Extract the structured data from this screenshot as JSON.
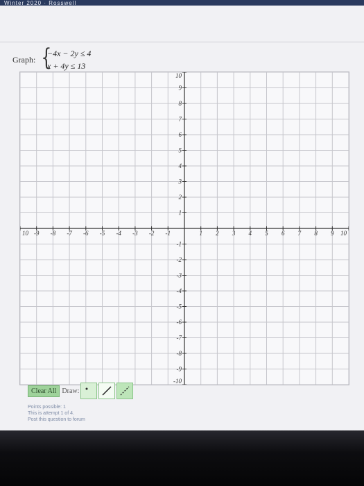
{
  "top_strip_text": "Winter 2020 · Rosswell",
  "problem": {
    "label": "Graph:",
    "inequality_1": "−4x − 2y ≤ 4",
    "inequality_2": "x + 4y ≤ 13"
  },
  "grid": {
    "x_range": [
      -10,
      10
    ],
    "y_range": [
      -10,
      10
    ],
    "x_tick_labels": [
      "10",
      "-9",
      "-8",
      "-7",
      "-6",
      "-5",
      "-4",
      "-3",
      "-2",
      "-1",
      "1",
      "2",
      "3",
      "4",
      "5",
      "6",
      "7",
      "8",
      "9",
      "10"
    ],
    "y_tick_labels": [
      "10",
      "9",
      "8",
      "7",
      "6",
      "5",
      "4",
      "3",
      "2",
      "1",
      "-1",
      "-2",
      "-3",
      "-4",
      "-5",
      "-6",
      "-7",
      "-8",
      "-9",
      "-10"
    ],
    "grid_color": "#c6c6cc",
    "axis_color": "#333333"
  },
  "controls": {
    "clear_label": "Clear All",
    "draw_label": "Draw:",
    "tools": [
      "point-icon",
      "solid-line-icon",
      "dashed-line-icon"
    ]
  },
  "status": {
    "points": "Points possible: 1",
    "attempt": "This is attempt 1 of 4.",
    "forum": "Post this question to forum"
  },
  "colors": {
    "clear_button": "#9ed29a",
    "tool_border": "#8cc58a",
    "status_text": "#7c8aa5"
  }
}
